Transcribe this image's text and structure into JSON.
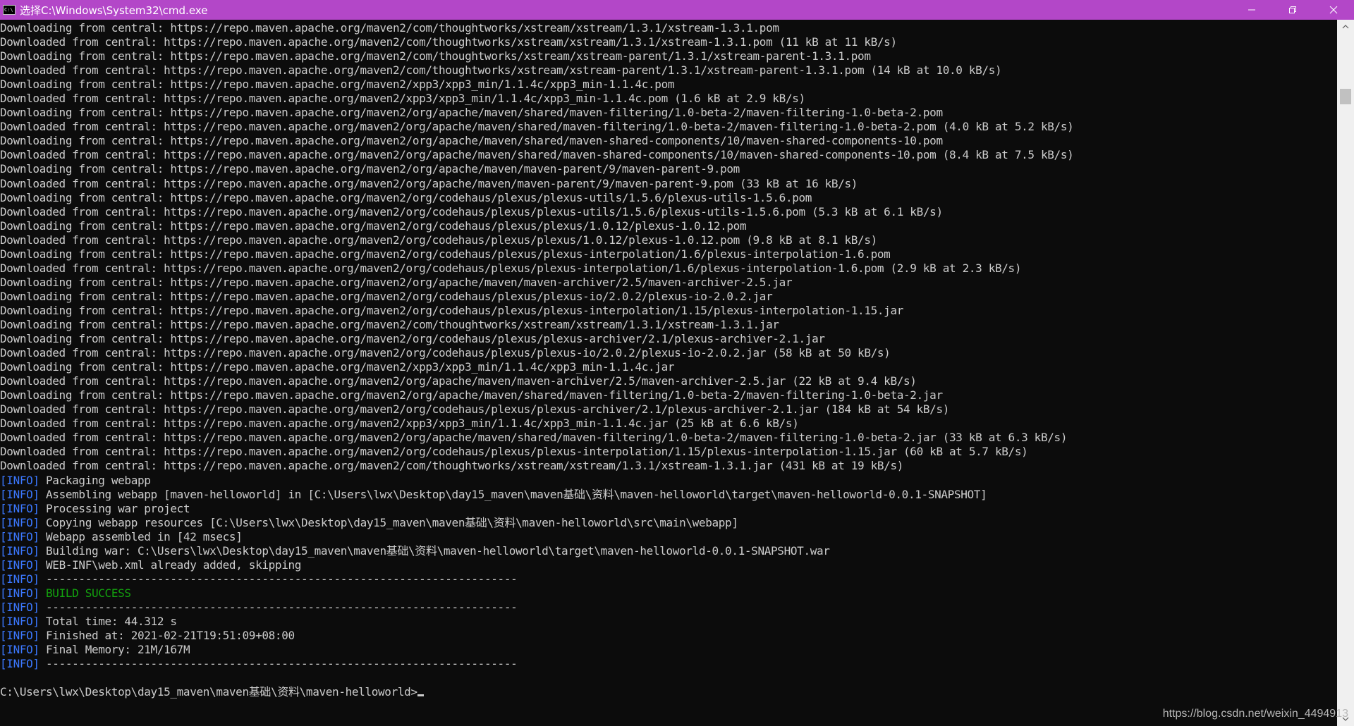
{
  "window": {
    "title": "选择C:\\Windows\\System32\\cmd.exe",
    "icon_text": "C:\\",
    "controls": [
      "minimize-icon",
      "restore-icon",
      "close-icon"
    ]
  },
  "colors": {
    "titlebar": "#b347c8",
    "background": "#0c0c0c",
    "text": "#cccccc",
    "info_tag": "#3b78ff",
    "success": "#13a10e"
  },
  "console": {
    "lines": [
      "Downloading from central: https://repo.maven.apache.org/maven2/com/thoughtworks/xstream/xstream/1.3.1/xstream-1.3.1.pom",
      "Downloaded from central: https://repo.maven.apache.org/maven2/com/thoughtworks/xstream/xstream/1.3.1/xstream-1.3.1.pom (11 kB at 11 kB/s)",
      "Downloading from central: https://repo.maven.apache.org/maven2/com/thoughtworks/xstream/xstream-parent/1.3.1/xstream-parent-1.3.1.pom",
      "Downloaded from central: https://repo.maven.apache.org/maven2/com/thoughtworks/xstream/xstream-parent/1.3.1/xstream-parent-1.3.1.pom (14 kB at 10.0 kB/s)",
      "Downloading from central: https://repo.maven.apache.org/maven2/xpp3/xpp3_min/1.1.4c/xpp3_min-1.1.4c.pom",
      "Downloaded from central: https://repo.maven.apache.org/maven2/xpp3/xpp3_min/1.1.4c/xpp3_min-1.1.4c.pom (1.6 kB at 2.9 kB/s)",
      "Downloading from central: https://repo.maven.apache.org/maven2/org/apache/maven/shared/maven-filtering/1.0-beta-2/maven-filtering-1.0-beta-2.pom",
      "Downloaded from central: https://repo.maven.apache.org/maven2/org/apache/maven/shared/maven-filtering/1.0-beta-2/maven-filtering-1.0-beta-2.pom (4.0 kB at 5.2 kB/s)",
      "Downloading from central: https://repo.maven.apache.org/maven2/org/apache/maven/shared/maven-shared-components/10/maven-shared-components-10.pom",
      "Downloaded from central: https://repo.maven.apache.org/maven2/org/apache/maven/shared/maven-shared-components/10/maven-shared-components-10.pom (8.4 kB at 7.5 kB/s)",
      "Downloading from central: https://repo.maven.apache.org/maven2/org/apache/maven/maven-parent/9/maven-parent-9.pom",
      "Downloaded from central: https://repo.maven.apache.org/maven2/org/apache/maven/maven-parent/9/maven-parent-9.pom (33 kB at 16 kB/s)",
      "Downloading from central: https://repo.maven.apache.org/maven2/org/codehaus/plexus/plexus-utils/1.5.6/plexus-utils-1.5.6.pom",
      "Downloaded from central: https://repo.maven.apache.org/maven2/org/codehaus/plexus/plexus-utils/1.5.6/plexus-utils-1.5.6.pom (5.3 kB at 6.1 kB/s)",
      "Downloading from central: https://repo.maven.apache.org/maven2/org/codehaus/plexus/plexus/1.0.12/plexus-1.0.12.pom",
      "Downloaded from central: https://repo.maven.apache.org/maven2/org/codehaus/plexus/plexus/1.0.12/plexus-1.0.12.pom (9.8 kB at 8.1 kB/s)",
      "Downloading from central: https://repo.maven.apache.org/maven2/org/codehaus/plexus/plexus-interpolation/1.6/plexus-interpolation-1.6.pom",
      "Downloaded from central: https://repo.maven.apache.org/maven2/org/codehaus/plexus/plexus-interpolation/1.6/plexus-interpolation-1.6.pom (2.9 kB at 2.3 kB/s)",
      "Downloading from central: https://repo.maven.apache.org/maven2/org/apache/maven/maven-archiver/2.5/maven-archiver-2.5.jar",
      "Downloading from central: https://repo.maven.apache.org/maven2/org/codehaus/plexus/plexus-io/2.0.2/plexus-io-2.0.2.jar",
      "Downloading from central: https://repo.maven.apache.org/maven2/org/codehaus/plexus/plexus-interpolation/1.15/plexus-interpolation-1.15.jar",
      "Downloading from central: https://repo.maven.apache.org/maven2/com/thoughtworks/xstream/xstream/1.3.1/xstream-1.3.1.jar",
      "Downloading from central: https://repo.maven.apache.org/maven2/org/codehaus/plexus/plexus-archiver/2.1/plexus-archiver-2.1.jar",
      "Downloaded from central: https://repo.maven.apache.org/maven2/org/codehaus/plexus/plexus-io/2.0.2/plexus-io-2.0.2.jar (58 kB at 50 kB/s)",
      "Downloading from central: https://repo.maven.apache.org/maven2/xpp3/xpp3_min/1.1.4c/xpp3_min-1.1.4c.jar",
      "Downloaded from central: https://repo.maven.apache.org/maven2/org/apache/maven/maven-archiver/2.5/maven-archiver-2.5.jar (22 kB at 9.4 kB/s)",
      "Downloading from central: https://repo.maven.apache.org/maven2/org/apache/maven/shared/maven-filtering/1.0-beta-2/maven-filtering-1.0-beta-2.jar",
      "Downloaded from central: https://repo.maven.apache.org/maven2/org/codehaus/plexus/plexus-archiver/2.1/plexus-archiver-2.1.jar (184 kB at 54 kB/s)",
      "Downloaded from central: https://repo.maven.apache.org/maven2/xpp3/xpp3_min/1.1.4c/xpp3_min-1.1.4c.jar (25 kB at 6.6 kB/s)",
      "Downloaded from central: https://repo.maven.apache.org/maven2/org/apache/maven/shared/maven-filtering/1.0-beta-2/maven-filtering-1.0-beta-2.jar (33 kB at 6.3 kB/s)",
      "Downloaded from central: https://repo.maven.apache.org/maven2/org/codehaus/plexus/plexus-interpolation/1.15/plexus-interpolation-1.15.jar (60 kB at 5.7 kB/s)",
      "Downloaded from central: https://repo.maven.apache.org/maven2/com/thoughtworks/xstream/xstream/1.3.1/xstream-1.3.1.jar (431 kB at 19 kB/s)"
    ],
    "info_prefix": "INFO",
    "info_lines": [
      {
        "text": "Packaging webapp",
        "success": false
      },
      {
        "text": "Assembling webapp [maven-helloworld] in [C:\\Users\\lwx\\Desktop\\day15_maven\\maven基础\\资料\\maven-helloworld\\target\\maven-helloworld-0.0.1-SNAPSHOT]",
        "success": false
      },
      {
        "text": "Processing war project",
        "success": false
      },
      {
        "text": "Copying webapp resources [C:\\Users\\lwx\\Desktop\\day15_maven\\maven基础\\资料\\maven-helloworld\\src\\main\\webapp]",
        "success": false
      },
      {
        "text": "Webapp assembled in [42 msecs]",
        "success": false
      },
      {
        "text": "Building war: C:\\Users\\lwx\\Desktop\\day15_maven\\maven基础\\资料\\maven-helloworld\\target\\maven-helloworld-0.0.1-SNAPSHOT.war",
        "success": false
      },
      {
        "text": "WEB-INF\\web.xml already added, skipping",
        "success": false
      },
      {
        "text": "------------------------------------------------------------------------",
        "success": false
      },
      {
        "text": "BUILD SUCCESS",
        "success": true
      },
      {
        "text": "------------------------------------------------------------------------",
        "success": false
      },
      {
        "text": "Total time: 44.312 s",
        "success": false
      },
      {
        "text": "Finished at: 2021-02-21T19:51:09+08:00",
        "success": false
      },
      {
        "text": "Final Memory: 21M/167M",
        "success": false
      },
      {
        "text": "------------------------------------------------------------------------",
        "success": false
      }
    ],
    "prompt": "C:\\Users\\lwx\\Desktop\\day15_maven\\maven基础\\资料\\maven-helloworld>"
  },
  "scrollbar": {
    "position_fraction": 0.1
  },
  "watermark": "https://blog.csdn.net/weixin_4494913"
}
